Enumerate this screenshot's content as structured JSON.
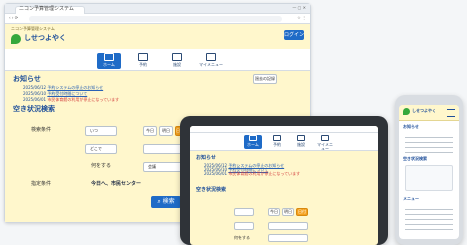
{
  "desktop": {
    "browser_tab_title": "ニコン予算管理システム",
    "app_name_small": "ニコン予算管理システム",
    "logo_text": "しせつよやく",
    "login_button": "ログイン",
    "nav": [
      "ホーム",
      "予約",
      "施設",
      "マイメニュー"
    ],
    "notice_title": "お知らせ",
    "notice_list_button": "過去の記録",
    "notices": [
      {
        "date": "2025/06/12",
        "text": "予約システムの停止のお知らせ"
      },
      {
        "date": "2025/06/10",
        "text": "予約受付時間について"
      },
      {
        "date": "2025/06/01",
        "text": "市民体育館の利用が停止になっています"
      }
    ],
    "search_title": "空き状況検索",
    "search_condition_label": "検索条件",
    "search_where_label": "いつ",
    "search_what_label": "どこで",
    "chips": [
      "今日",
      "明日",
      "日付指定"
    ],
    "purpose_label": "何をする",
    "purpose_value": "会議",
    "specified_label": "指定条件",
    "specified_text": "今日へ、市民センター",
    "search_button": "検索"
  },
  "tablet": {
    "nav": [
      "ホーム",
      "予約",
      "施設",
      "マイメニュー"
    ],
    "notice_title": "お知らせ",
    "notices": [
      {
        "date": "2025/06/12",
        "text": "予約システムの停止のお知らせ"
      },
      {
        "date": "2025/06/10",
        "text": "予約受付時間について"
      },
      {
        "date": "2025/06/01",
        "text": "市民体育館の利用が停止になっています"
      }
    ],
    "search_title": "空き状況検索",
    "chips": [
      "今日",
      "明日",
      "日付"
    ],
    "purpose_label": "何をする"
  },
  "phone": {
    "logo_text": "しせつよやく",
    "notice_title": "お知らせ",
    "search_title": "空き状況検索",
    "menu_title": "メニュー"
  },
  "colors": {
    "primary": "#1f6bc7",
    "accent": "#f4a11f",
    "pageBg": "#fff7cc",
    "link": "#2a62b5",
    "warning": "#d23b3b"
  }
}
